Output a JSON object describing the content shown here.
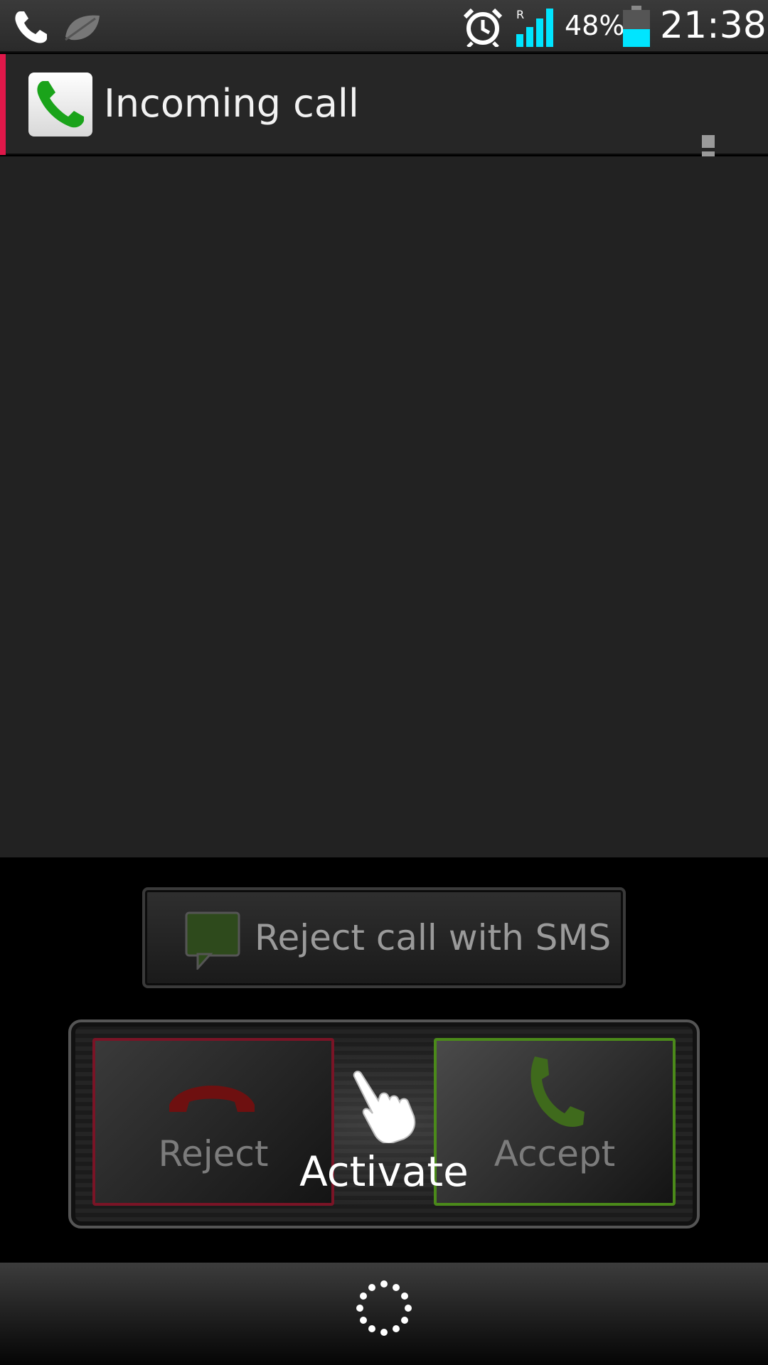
{
  "status_bar": {
    "icons": [
      "phone-icon",
      "leaf-icon",
      "alarm-icon",
      "signal-icon",
      "battery-icon"
    ],
    "roaming": "R",
    "battery_percent": "48%",
    "battery_level": 0.48,
    "time": "21:38"
  },
  "title_bar": {
    "title": "Incoming call",
    "app_icon": "phone-icon",
    "accent_color": "#e0184a",
    "menu_icon": "overflow-menu-icon"
  },
  "actions": {
    "sms_button": {
      "label": "Reject call with SMS",
      "icon": "sms-icon"
    },
    "reject": {
      "label": "Reject",
      "icon": "hang-up-icon",
      "color": "#7a1426"
    },
    "accept": {
      "label": "Accept",
      "icon": "phone-icon",
      "color": "#4b8a1a"
    },
    "hint_icon": "pointing-hand-icon",
    "activate_label": "Activate"
  },
  "nav_bar": {
    "icon": "home-ring-icon"
  }
}
